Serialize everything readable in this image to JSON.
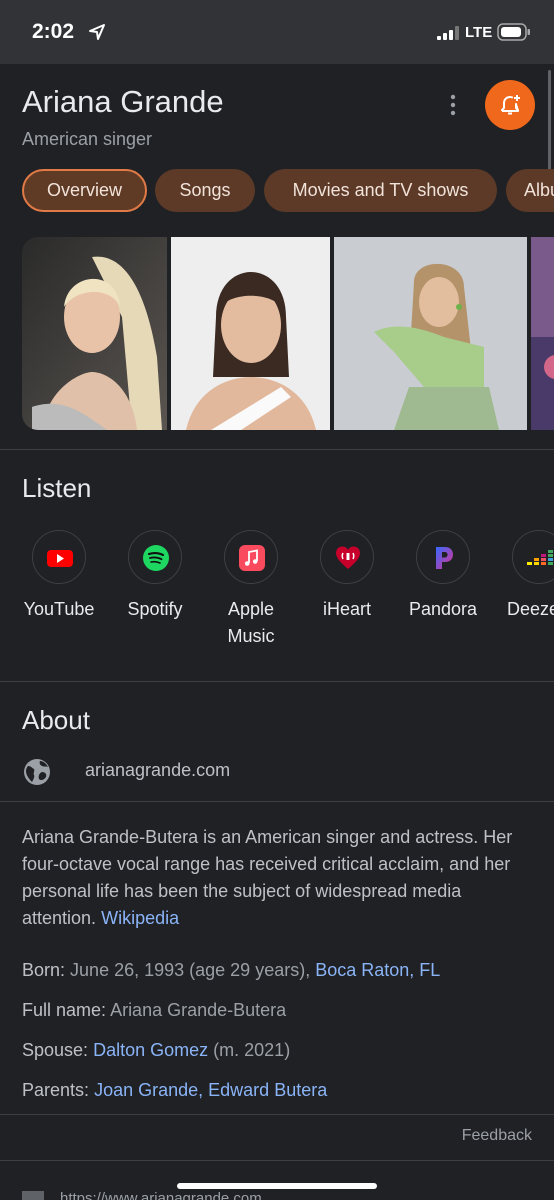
{
  "status": {
    "time": "2:02",
    "network": "LTE"
  },
  "entity": {
    "title": "Ariana Grande",
    "subtitle": "American singer"
  },
  "chips": [
    {
      "label": "Overview",
      "active": true
    },
    {
      "label": "Songs",
      "active": false
    },
    {
      "label": "Movies and TV shows",
      "active": false
    },
    {
      "label": "Albums",
      "active": false
    }
  ],
  "listen": {
    "heading": "Listen",
    "items": [
      {
        "label": "YouTube",
        "icon": "youtube-icon",
        "color": "#ff0000"
      },
      {
        "label": "Spotify",
        "icon": "spotify-icon",
        "color": "#1ed760"
      },
      {
        "label": "Apple Music",
        "icon": "apple-music-icon",
        "color": "#fa4a5e"
      },
      {
        "label": "iHeart",
        "icon": "iheart-icon",
        "color": "#c6002b"
      },
      {
        "label": "Pandora",
        "icon": "pandora-icon",
        "color": "#e0338e"
      },
      {
        "label": "Deezer",
        "icon": "deezer-icon",
        "color": "#ef5466"
      }
    ]
  },
  "about": {
    "heading": "About",
    "website": "arianagrande.com",
    "description": "Ariana Grande-Butera is an American singer and actress. Her four-octave vocal range has received critical acclaim, and her personal life has been the subject of widespread media attention.",
    "source_link": "Wikipedia",
    "facts": {
      "born": {
        "label": "Born:",
        "value": "June 26, 1993 (age 29 years),",
        "link": "Boca Raton, FL"
      },
      "full_name": {
        "label": "Full name:",
        "value": "Ariana Grande-Butera"
      },
      "spouse": {
        "label": "Spouse:",
        "link": "Dalton Gomez",
        "value": "(m. 2021)"
      },
      "parents": {
        "label": "Parents:",
        "link1": "Joan Grande,",
        "link2": "Edward Butera"
      }
    },
    "feedback": "Feedback"
  },
  "bottom": {
    "url": "https://www.arianagrande.com"
  },
  "colors": {
    "accent": "#f0681c",
    "chip_bg": "#5c3a27",
    "link": "#8ab4f8",
    "background": "#202124"
  }
}
